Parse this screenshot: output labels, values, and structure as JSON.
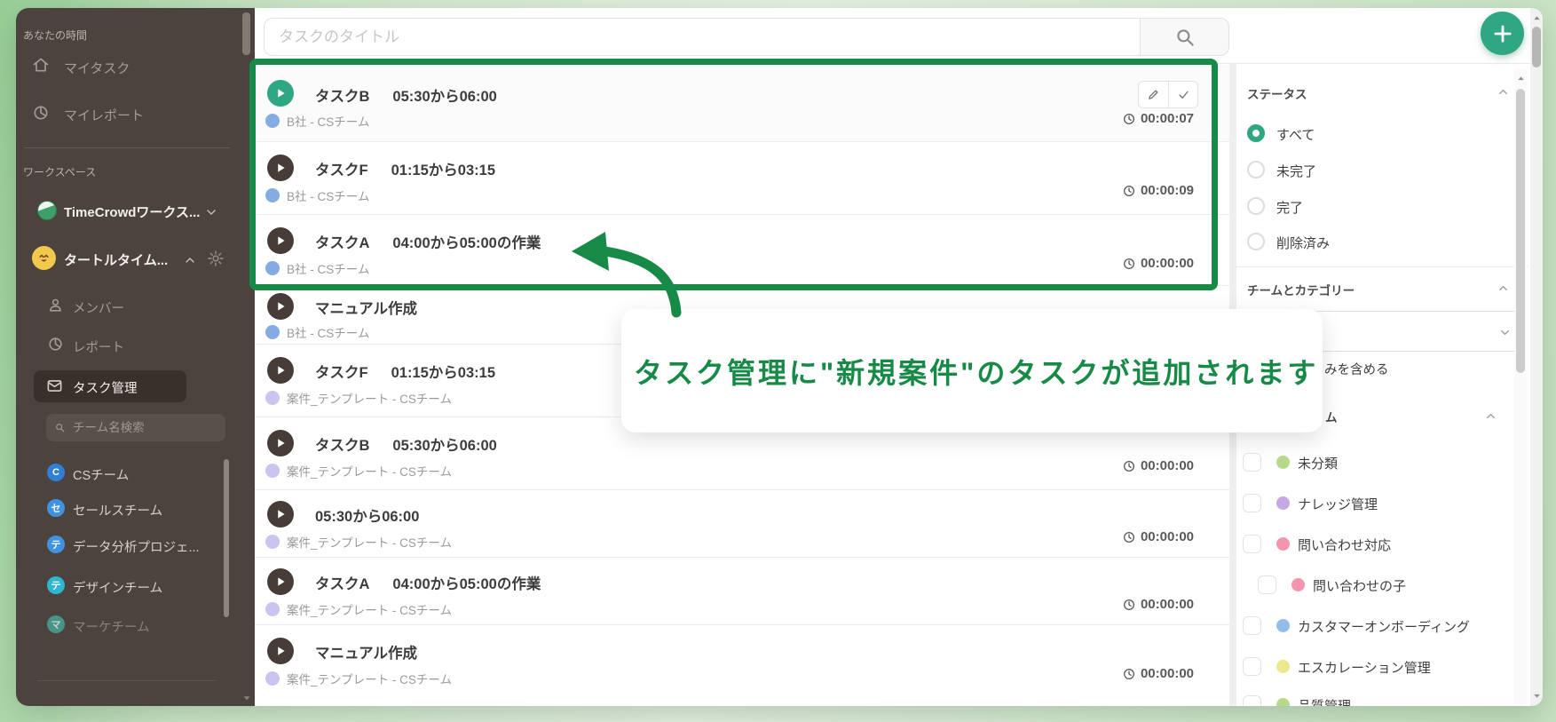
{
  "colors": {
    "annotation_green": "#178a47",
    "accent_teal": "#2fa783"
  },
  "sidebar": {
    "section_your_time": "あなたの時間",
    "my_tasks": "マイタスク",
    "my_report": "マイレポート",
    "section_workspace": "ワークスペース",
    "workspace_name": "TimeCrowdワークス...",
    "team_name": "タートルタイム...",
    "members": "メンバー",
    "report": "レポート",
    "task_management": "タスク管理",
    "team_search_placeholder": "チーム名検索",
    "teams": [
      {
        "label": "CSチーム",
        "initial": "C",
        "color": "#2f7fd6"
      },
      {
        "label": "セールスチーム",
        "initial": "セ",
        "color": "#3f93e0"
      },
      {
        "label": "データ分析プロジェ...",
        "initial": "テ",
        "color": "#3f93e0"
      },
      {
        "label": "デザインチーム",
        "initial": "テ",
        "color": "#2fb6d0"
      },
      {
        "label": "マーケチーム",
        "initial": "マ",
        "color": "#49afa4"
      }
    ]
  },
  "topbar": {
    "task_title_placeholder": "タスクのタイトル"
  },
  "tasks": [
    {
      "name": "タスクB",
      "time": "05:30から06:00",
      "project": "B社 - CSチーム",
      "dot_color": "#85abe4",
      "timer": "00:00:07"
    },
    {
      "name": "タスクF",
      "time": "01:15から03:15",
      "project": "B社 - CSチーム",
      "dot_color": "#85abe4",
      "timer": "00:00:09"
    },
    {
      "name": "タスクA",
      "time": "04:00から05:00の作業",
      "project": "B社 - CSチーム",
      "dot_color": "#85abe4",
      "timer": "00:00:00"
    },
    {
      "name": "マニュアル作成",
      "time": "",
      "project": "B社 - CSチーム",
      "dot_color": "#85abe4",
      "timer": ""
    },
    {
      "name": "タスクF",
      "time": "01:15から03:15",
      "project": "案件_テンプレート - CSチーム",
      "dot_color": "#c9c4f0",
      "timer": ""
    },
    {
      "name": "タスクB",
      "time": "05:30から06:00",
      "project": "案件_テンプレート - CSチーム",
      "dot_color": "#c9c4f0",
      "timer": "00:00:00"
    },
    {
      "name": "05:30から06:00",
      "time": "",
      "project": "案件_テンプレート - CSチーム",
      "dot_color": "#c9c4f0",
      "timer": "00:00:00"
    },
    {
      "name": "タスクA",
      "time": "04:00から05:00の作業",
      "project": "案件_テンプレート - CSチーム",
      "dot_color": "#c9c4f0",
      "timer": "00:00:00"
    },
    {
      "name": "マニュアル作成",
      "time": "",
      "project": "案件_テンプレート - CSチーム",
      "dot_color": "#c9c4f0",
      "timer": "00:00:00"
    }
  ],
  "filters": {
    "status_title": "ステータス",
    "status_options": [
      {
        "label": "すべて"
      },
      {
        "label": "未完了"
      },
      {
        "label": "完了"
      },
      {
        "label": "削除済み"
      }
    ],
    "team_category_title": "チームとカテゴリー",
    "include_completed_partial": "みを含める",
    "team_header_partial": "ム",
    "categories": [
      {
        "label": "未分類",
        "color": "#b7d98b"
      },
      {
        "label": "ナレッジ管理",
        "color": "#c6a8e2"
      },
      {
        "label": "問い合わせ対応",
        "color": "#f495ad"
      },
      {
        "label": "問い合わせの子",
        "color": "#f495ad"
      },
      {
        "label": "カスタマーオンボーディング",
        "color": "#93bee9"
      },
      {
        "label": "エスカレーション管理",
        "color": "#ece98d"
      },
      {
        "label": "品質管理",
        "color": "#b7d98b"
      }
    ]
  },
  "annotation": {
    "callout": "タスク管理に\"新規案件\"のタスクが追加されます"
  }
}
